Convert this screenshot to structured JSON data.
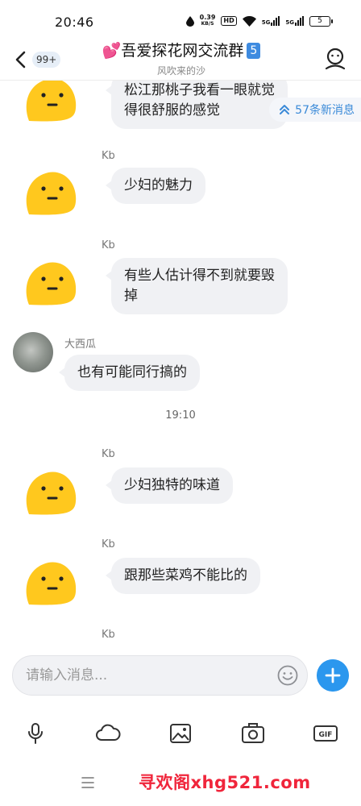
{
  "status_bar": {
    "time": "20:46",
    "net_speed_value": "0.39",
    "net_speed_unit": "KB/S",
    "hd_label": "HD",
    "signal1_label": "5G",
    "signal2_label": "5G",
    "battery_level": "5"
  },
  "header": {
    "unread_count": "99+",
    "title_emoji": "💕",
    "title": "吾爱探花网交流群",
    "title_badge": "5",
    "subtitle": "风吹来的沙"
  },
  "new_messages": "57条新消息",
  "messages": [
    {
      "sender": "",
      "text_line1": "松江那桃子我看一眼就觉",
      "text_line2": "得很舒服的感觉"
    },
    {
      "sender": "Kb",
      "text": "少妇的魅力"
    },
    {
      "sender": "Kb",
      "text_line1": "有些人估计得不到就要毁",
      "text_line2": "掉"
    },
    {
      "sender": "大西瓜",
      "text": "也有可能同行搞的"
    },
    {
      "sender": "Kb",
      "text": "少妇独特的味道"
    },
    {
      "sender": "Kb",
      "text": "跟那些菜鸡不能比的"
    },
    {
      "sender": "Kb",
      "text": ""
    }
  ],
  "time_separator": "19:10",
  "input": {
    "placeholder": "请输入消息..."
  },
  "watermark": "寻欢阁xhg521.com",
  "colors": {
    "accent": "#2b97ee",
    "bubble": "#f0f1f4",
    "watermark": "#f0253b",
    "duck": "#ffc81e"
  }
}
